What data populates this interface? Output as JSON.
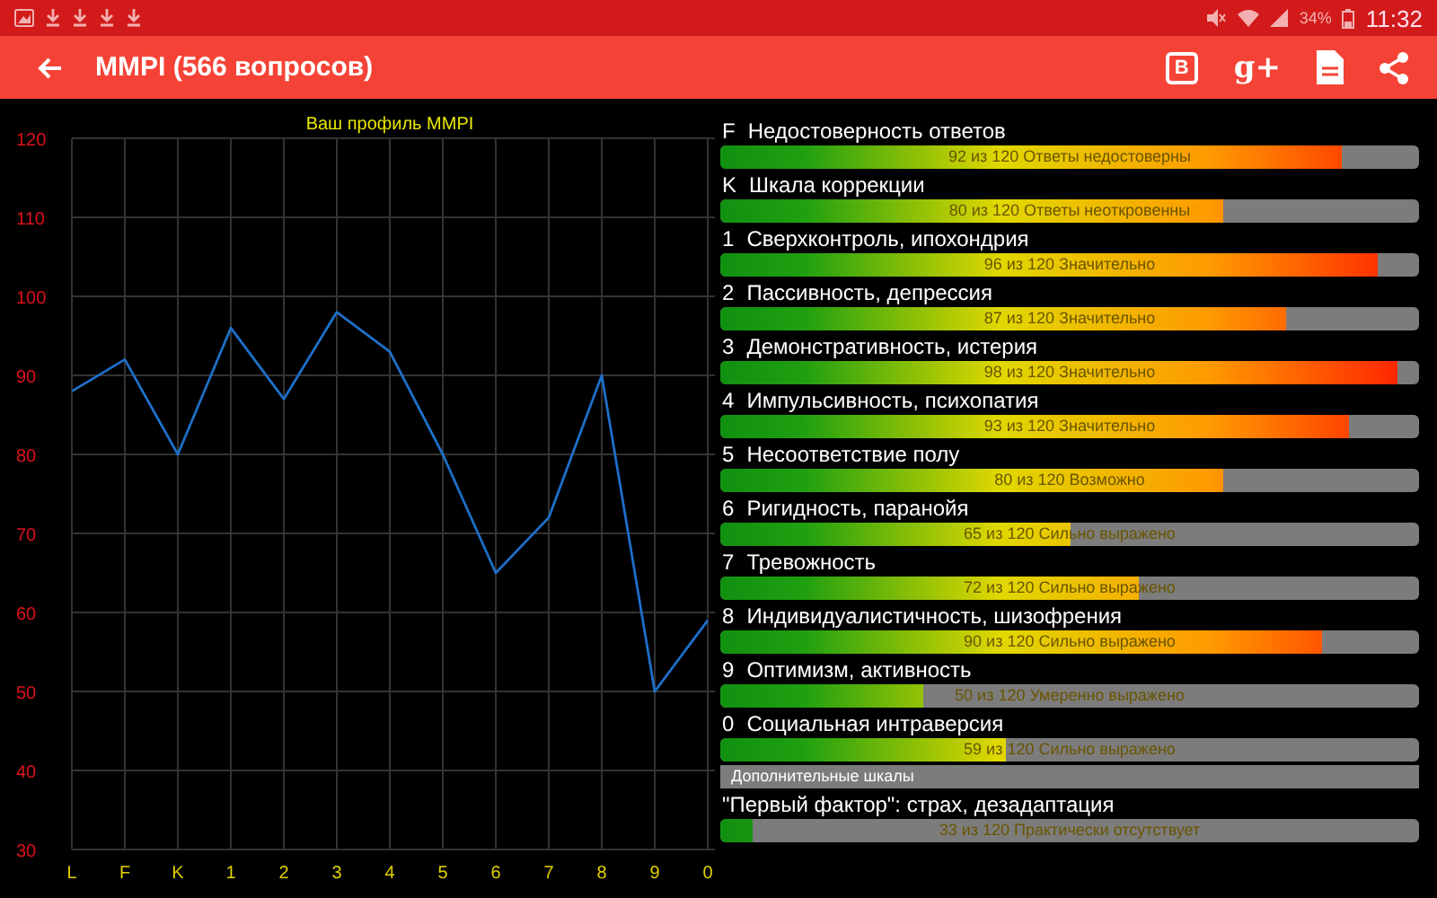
{
  "status_bar": {
    "battery": "34%",
    "time": "11:32"
  },
  "app_bar": {
    "title": "MMPI (566 вопросов)",
    "actions": [
      {
        "kind": "letter",
        "label": "B"
      },
      {
        "kind": "letter-plain",
        "label": "g+"
      },
      {
        "kind": "document"
      },
      {
        "kind": "share"
      }
    ]
  },
  "chart_data": {
    "type": "line",
    "title": "Ваш профиль MMPI",
    "categories": [
      "L",
      "F",
      "K",
      "1",
      "2",
      "3",
      "4",
      "5",
      "6",
      "7",
      "8",
      "9",
      "0"
    ],
    "grid": true,
    "series": [
      {
        "color": "#1e6fc8",
        "values": [
          88,
          92,
          80,
          96,
          87,
          98,
          93,
          80,
          65,
          72,
          90,
          50,
          59
        ]
      }
    ],
    "ylim": [
      30,
      120
    ],
    "yticks": [
      30,
      40,
      50,
      60,
      70,
      80,
      90,
      100,
      110,
      120
    ]
  },
  "scales": [
    {
      "kind": "scale",
      "code": "F",
      "name": "Недостоверность ответов",
      "level": 0.89,
      "reading": "92 из 120 Ответы недостоверны"
    },
    {
      "kind": "scale",
      "code": "K",
      "name": "Шкала коррекции",
      "level": 0.72,
      "reading": "80 из 120 Ответы неоткровенны"
    },
    {
      "kind": "scale",
      "code": "1",
      "name": "Сверхконтроль, ипохондрия",
      "level": 0.94,
      "reading": "96 из 120 Значительно"
    },
    {
      "kind": "scale",
      "code": "2",
      "name": "Пассивность, депрессия",
      "level": 0.81,
      "reading": "87 из 120 Значительно"
    },
    {
      "kind": "scale",
      "code": "3",
      "name": "Демонстративность, истерия",
      "level": 0.97,
      "reading": "98 из 120 Значительно"
    },
    {
      "kind": "scale",
      "code": "4",
      "name": "Импульсивность, психопатия",
      "level": 0.9,
      "reading": "93 из 120 Значительно"
    },
    {
      "kind": "scale",
      "code": "5",
      "name": "Несоответствие полу",
      "level": 0.72,
      "reading": "80 из 120 Возможно"
    },
    {
      "kind": "scale",
      "code": "6",
      "name": "Ригидность, паранойя",
      "level": 0.5,
      "reading": "65 из 120 Сильно выражено"
    },
    {
      "kind": "scale",
      "code": "7",
      "name": "Тревожность",
      "level": 0.6,
      "reading": "72 из 120 Сильно выражено"
    },
    {
      "kind": "scale",
      "code": "8",
      "name": "Индивидуалистичность, шизофрения",
      "level": 0.86,
      "reading": "90 из 120 Сильно выражено"
    },
    {
      "kind": "scale",
      "code": "9",
      "name": "Оптимизм, активность",
      "level": 0.29,
      "reading": "50 из 120 Умеренно выражено"
    },
    {
      "kind": "scale",
      "code": "0",
      "name": "Социальная интраверсия",
      "level": 0.41,
      "reading": "59 из 120 Сильно выражено"
    },
    {
      "kind": "header",
      "name": "Дополнительные шкалы"
    },
    {
      "kind": "scale",
      "name": "\"Первый фактор\": страх, дезадаптация",
      "level": 0.045,
      "reading": "33 из 120 Практически отсутствует"
    }
  ]
}
